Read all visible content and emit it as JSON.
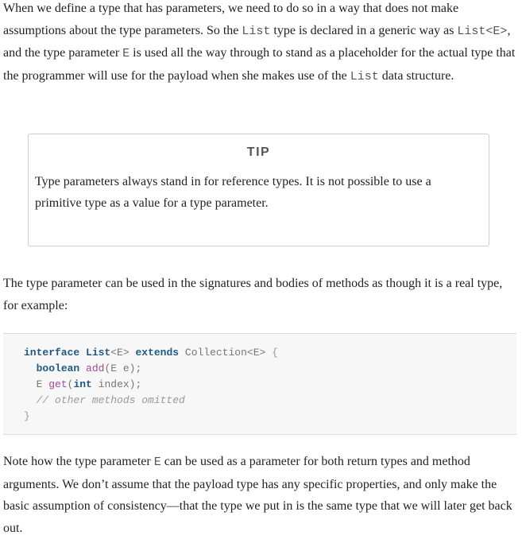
{
  "paragraph1": {
    "t1": "When we define a type that has parameters, we need to do so in a way that does not make assumptions about the type parameters. So the ",
    "c1": "List",
    "t2": " type is declared in a generic way as ",
    "c2": "List<E>",
    "t3": ", and the type parameter ",
    "c3": "E",
    "t4": " is used all the way through to stand as a placeholder for the actual type that the programmer will use for the payload when she makes use of the ",
    "c4": "List",
    "t5": " data structure."
  },
  "tip": {
    "title": "TIP",
    "body": "Type parameters always stand in for reference types. It is not possible to use a primitive type as a value for a type parameter."
  },
  "paragraph2": {
    "text": "The type parameter can be used in the signatures and bodies of methods as though it is a real type, for example:"
  },
  "code": {
    "l1_kw1": "interface",
    "l1_name": "List",
    "l1_gen": "<E>",
    "l1_kw2": "extends",
    "l1_parent": "Collection<E>",
    "l1_brace": "{",
    "l2_kw": "boolean",
    "l2_fn": "add",
    "l2_args": "(E e);",
    "l3_type": "E",
    "l3_fn": "get",
    "l3_open": "(",
    "l3_kw": "int",
    "l3_rest": "index);",
    "l4_comment": "// other methods omitted",
    "l5_brace": "}"
  },
  "paragraph3": {
    "t1": "Note how the type parameter ",
    "c1": "E",
    "t2": " can be used as a parameter for both return types and method arguments. We don’t assume that the payload type has any specific properties, and only make the basic assumption of consistency—that the type we put in is the same type that we will later get back out."
  }
}
